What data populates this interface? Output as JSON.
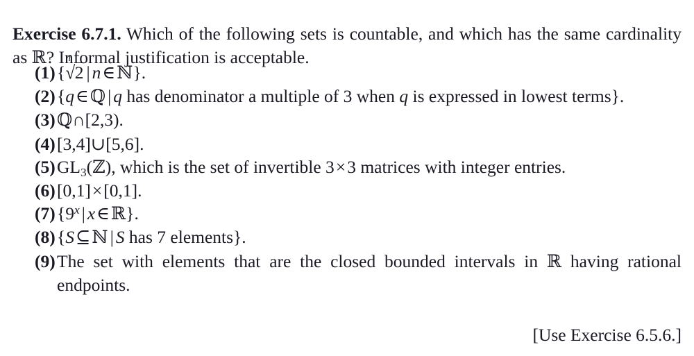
{
  "document": {
    "type": "textbook-exercise",
    "background_color": "#ffffff",
    "text_color": "#1a1a24"
  },
  "exercise": {
    "label": "Exercise 6.7.1.",
    "prompt": "Which of the following sets is countable, and which has the same cardinality as ℝ? Informal justification is acceptable.",
    "prompt_part_1": "Which of the following sets is countable, and which has the same cardinality as ",
    "prompt_symbol": "ℝ",
    "prompt_part_2": "? Informal justification is acceptable."
  },
  "items": [
    {
      "marker": "(1)",
      "text": "{ⁿ√2 | n ∈ ℕ}.",
      "parts": {
        "open": "{",
        "root_index": "n",
        "root_sign": "√",
        "radicand": "2",
        "bar": "|",
        "var": "n",
        "member": "∈",
        "set": "ℕ",
        "close": "}."
      }
    },
    {
      "marker": "(2)",
      "text": "{q ∈ ℚ | q has denominator a multiple of 3 when q is expressed in lowest terms}.",
      "parts": {
        "open": "{",
        "var": "q",
        "member": "∈",
        "set": "ℚ",
        "bar": "|",
        "var2": "q",
        "mid_text": " has denominator a multiple of 3 when ",
        "var3": "q",
        "tail_text": " is expressed in lowest terms",
        "close": "}."
      }
    },
    {
      "marker": "(3)",
      "text": "ℚ∩[2,3).",
      "parts": {
        "set": "ℚ",
        "op": "∩",
        "interval": "[2,3)."
      }
    },
    {
      "marker": "(4)",
      "text": "[3,4]∪[5,6].",
      "parts": {
        "left": "[3,4]",
        "op": "∪",
        "right": "[5,6]."
      }
    },
    {
      "marker": "(5)",
      "text": "GL₃(ℤ), which is the set of invertible 3 × 3 matrices with integer entries.",
      "parts": {
        "name": "GL",
        "subscript": "3",
        "open": "(",
        "set": "ℤ",
        "close": "),",
        "tail_a": " which is the set of invertible 3",
        "times": "×",
        "tail_b": "3 matrices with integer entries."
      }
    },
    {
      "marker": "(6)",
      "text": "[0,1] × [0,1].",
      "parts": {
        "left": "[0,1]",
        "op": "×",
        "right": "[0,1]."
      }
    },
    {
      "marker": "(7)",
      "text": "{9ˣ | x ∈ ℝ}.",
      "parts": {
        "open": "{",
        "base": "9",
        "exponent": "x",
        "bar": "|",
        "var": "x",
        "member": "∈",
        "set": "ℝ",
        "close": "}."
      }
    },
    {
      "marker": "(8)",
      "text": "{S ⊆ ℕ | S has 7 elements}.",
      "parts": {
        "open": "{",
        "var": "S",
        "subset": "⊆",
        "set": "ℕ",
        "bar": "|",
        "var2": "S",
        "tail_text": " has 7 elements",
        "close": "}."
      }
    },
    {
      "marker": "(9)",
      "text": "The set with elements that are the closed bounded intervals in ℝ having rational endpoints.",
      "parts": {
        "head": "The set with elements that are the closed bounded intervals in ",
        "set": "ℝ",
        "tail": " having ra­tional endpoints."
      }
    }
  ],
  "reference_note": "[Use Exercise 6.5.6.]"
}
